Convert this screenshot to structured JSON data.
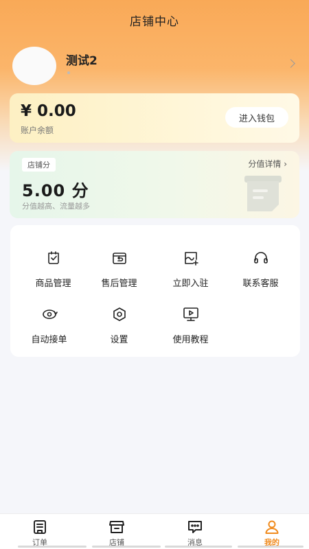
{
  "header": {
    "title": "店铺中心"
  },
  "profile": {
    "shop_name": "测试2"
  },
  "wallet": {
    "balance": "¥ 0.00",
    "balance_label": "账户余额",
    "button_label": "进入钱包"
  },
  "score": {
    "tag": "店铺分",
    "detail_link": "分值详情 ›",
    "value": "5.00 分",
    "hint": "分值越高、流量越多"
  },
  "grid": {
    "items": [
      {
        "label": "商品管理",
        "icon": "product-icon"
      },
      {
        "label": "售后管理",
        "icon": "after-sales-icon"
      },
      {
        "label": "立即入驻",
        "icon": "join-icon"
      },
      {
        "label": "联系客服",
        "icon": "headset-icon"
      },
      {
        "label": "自动接单",
        "icon": "auto-order-icon"
      },
      {
        "label": "设置",
        "icon": "settings-icon"
      },
      {
        "label": "使用教程",
        "icon": "tutorial-icon"
      }
    ]
  },
  "tabbar": {
    "active_color": "#f08a1c",
    "items": [
      {
        "label": "订单",
        "icon": "orders-icon"
      },
      {
        "label": "店铺",
        "icon": "store-icon"
      },
      {
        "label": "消息",
        "icon": "message-icon"
      },
      {
        "label": "我的",
        "icon": "user-icon"
      }
    ]
  }
}
